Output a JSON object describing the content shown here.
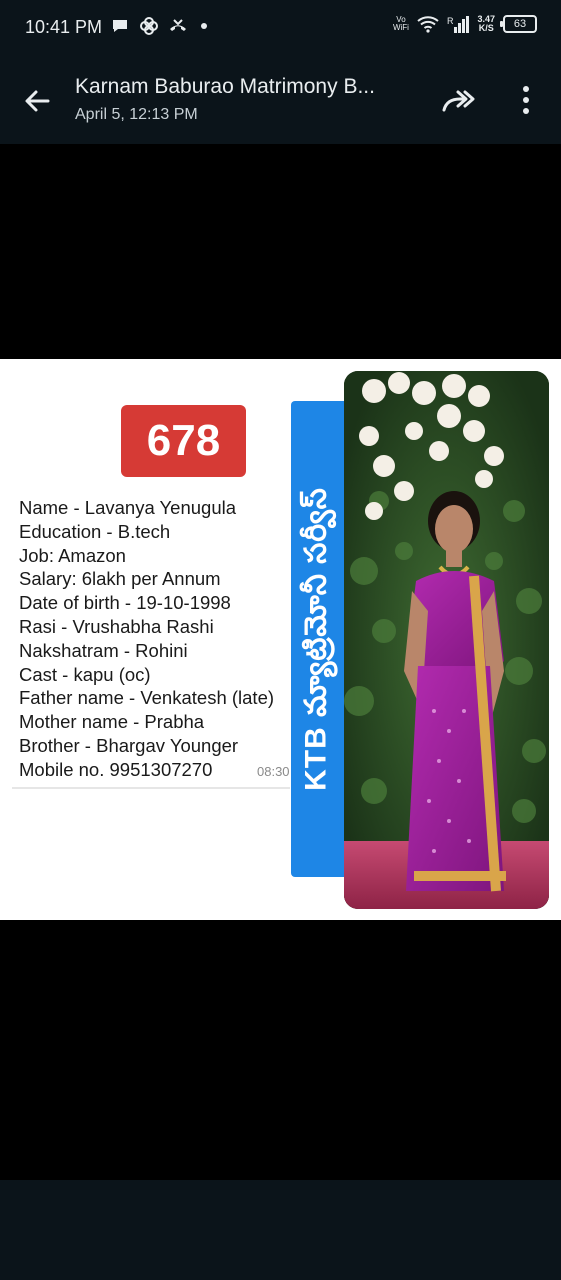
{
  "status_bar": {
    "time": "10:41 PM",
    "vowifi_top": "Vo",
    "vowifi_bottom": "WiFi",
    "network_label": "R",
    "speed_value": "3.47",
    "speed_unit": "K/S",
    "battery": "63"
  },
  "header": {
    "title": "Karnam Baburao Matrimony B...",
    "subtitle": "April 5, 12:13 PM"
  },
  "profile_card": {
    "badge_number": "678",
    "details": [
      "Name - Lavanya Yenugula",
      "Education - B.tech",
      "Job: Amazon",
      "Salary: 6lakh per Annum",
      "Date of birth - 19-10-1998",
      "Rasi - Vrushabha Rashi",
      "Nakshatram - Rohini",
      "Cast - kapu (oc)",
      "Father name - Venkatesh (late)",
      "Mother name - Prabha",
      "Brother - Bhargav Younger",
      "Mobile no. 9951307270"
    ],
    "message_time": "08:30",
    "banner_text": "KTB మ్యాట్రిమోనీ సర్వీస్"
  },
  "colors": {
    "header_bg": "#0b141a",
    "badge_red": "#d63a35",
    "banner_blue": "#1e86e6",
    "saree_magenta": "#a0209e"
  }
}
